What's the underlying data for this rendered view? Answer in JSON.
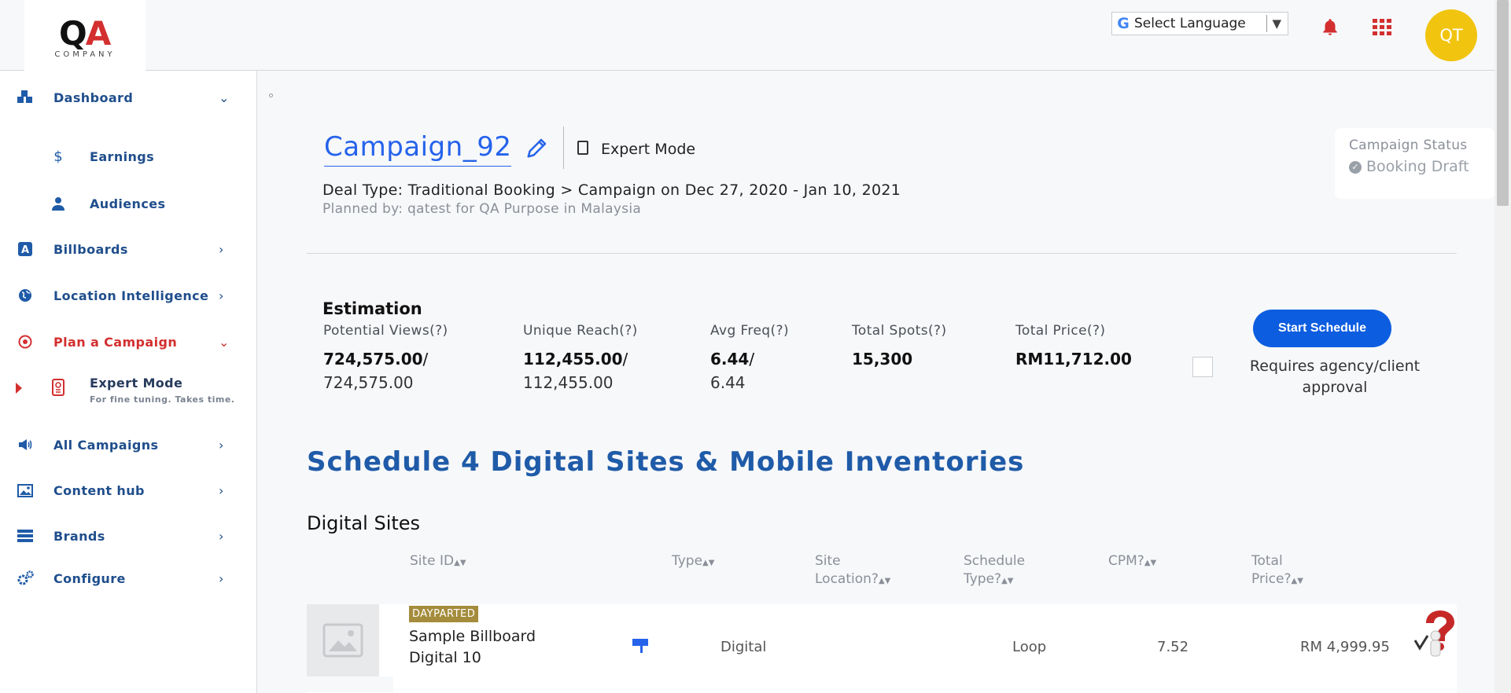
{
  "header": {
    "logo": {
      "mark_a": "Q",
      "mark_b": "A",
      "text": "COMPANY"
    },
    "language": {
      "label": "Select Language",
      "arrow": "▼"
    },
    "avatar_initials": "QT"
  },
  "sidebar": {
    "dashboard": "Dashboard",
    "earnings": "Earnings",
    "audiences": "Audiences",
    "billboards": "Billboards",
    "location_intelligence": "Location Intelligence",
    "plan_campaign": "Plan a Campaign",
    "expert_mode": "Expert Mode",
    "expert_hint": "For fine tuning. Takes time.",
    "all_campaigns": "All Campaigns",
    "content_hub": "Content hub",
    "brands": "Brands",
    "configure": "Configure"
  },
  "campaign": {
    "title": "Campaign_92",
    "mode": "Expert Mode",
    "deal_line": "Deal Type: Traditional Booking > Campaign on Dec 27, 2020 - Jan 10, 2021",
    "planned_line": "Planned by: qatest for QA Purpose in Malaysia",
    "status_title": "Campaign Status",
    "status_value": "Booking Draft"
  },
  "estimation": {
    "title": "Estimation",
    "metrics": [
      {
        "label": "Potential Views(?)",
        "value": "724,575.00",
        "slash": "/",
        "value2": "724,575.00"
      },
      {
        "label": "Unique Reach(?)",
        "value": "112,455.00",
        "slash": "/",
        "value2": "112,455.00"
      },
      {
        "label": "Avg Freq(?)",
        "value": "6.44",
        "slash": "/",
        "value2": "6.44"
      },
      {
        "label": "Total Spots(?)",
        "value": "15,300"
      },
      {
        "label": "Total Price(?)",
        "value": "RM11,712.00"
      }
    ],
    "start_button": "Start Schedule",
    "approval_text": "Requires agency/client approval"
  },
  "schedule": {
    "heading": "Schedule 4 Digital Sites & Mobile Inventories",
    "subheading": "Digital Sites",
    "columns": {
      "site_id": "Site ID",
      "type": "Type",
      "site_location_1": "Site",
      "site_location_2": "Location?",
      "schedule_type_1": "Schedule",
      "schedule_type_2": "Type?",
      "cpm": "CPM?",
      "total_price_1": "Total",
      "total_price_2": "Price?"
    },
    "rows": [
      {
        "badge": "DAYPARTED",
        "site_name": "Sample Billboard Digital 10",
        "type": "Digital",
        "schedule_type": "Loop",
        "cpm": "7.52",
        "total_price": "RM 4,999.95"
      }
    ]
  },
  "colors": {
    "accent_blue": "#2563eb",
    "nav_blue": "#1f4e8c",
    "active_red": "#d32f2f",
    "button_blue": "#0d5de0",
    "badge_gold": "#a48c3c",
    "avatar_yellow": "#f1c40f"
  }
}
